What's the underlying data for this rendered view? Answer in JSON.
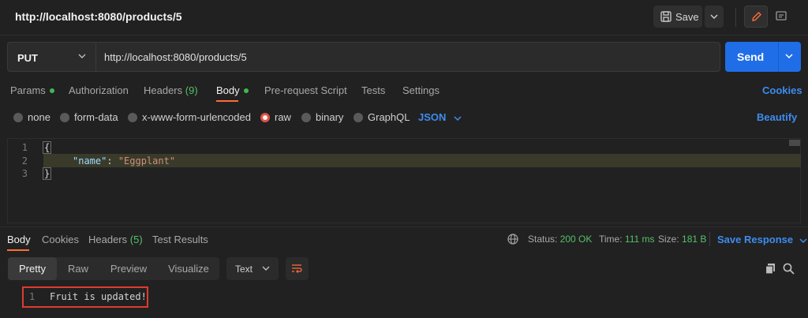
{
  "header": {
    "title": "http://localhost:8080/products/5",
    "save_label": "Save"
  },
  "request": {
    "method": "PUT",
    "url": "http://localhost:8080/products/5",
    "send_label": "Send"
  },
  "tabs": [
    {
      "label": "Params",
      "dot": true
    },
    {
      "label": "Authorization"
    },
    {
      "label": "Headers",
      "count": "(9)"
    },
    {
      "label": "Body",
      "dot": true,
      "active": true
    },
    {
      "label": "Pre-request Script"
    },
    {
      "label": "Tests"
    },
    {
      "label": "Settings"
    }
  ],
  "cookies_label": "Cookies",
  "body_types": [
    "none",
    "form-data",
    "x-www-form-urlencoded",
    "raw",
    "binary",
    "GraphQL"
  ],
  "body_type_selected": "raw",
  "body_format": "JSON",
  "beautify_label": "Beautify",
  "editor": {
    "line_numbers": [
      "1",
      "2",
      "3"
    ],
    "open_brace": "{",
    "key": "\"name\"",
    "colon": ": ",
    "value": "\"Eggplant\"",
    "close_brace": "}"
  },
  "response": {
    "tabs": [
      {
        "label": "Body",
        "active": true
      },
      {
        "label": "Cookies"
      },
      {
        "label": "Headers",
        "count": "(5)"
      },
      {
        "label": "Test Results"
      }
    ],
    "status_label": "Status:",
    "status_value": "200 OK",
    "time_label": "Time:",
    "time_value": "111 ms",
    "size_label": "Size:",
    "size_value": "181 B",
    "save_response_label": "Save Response",
    "view_tabs": [
      "Pretty",
      "Raw",
      "Preview",
      "Visualize"
    ],
    "view_active": "Pretty",
    "format": "Text",
    "line_number": "1",
    "body_text": "Fruit is updated!"
  },
  "colors": {
    "accent_blue": "#1f6ee8",
    "accent_orange": "#ff6c37",
    "status_green": "#56c06a",
    "highlight_red": "#e03a2f"
  }
}
